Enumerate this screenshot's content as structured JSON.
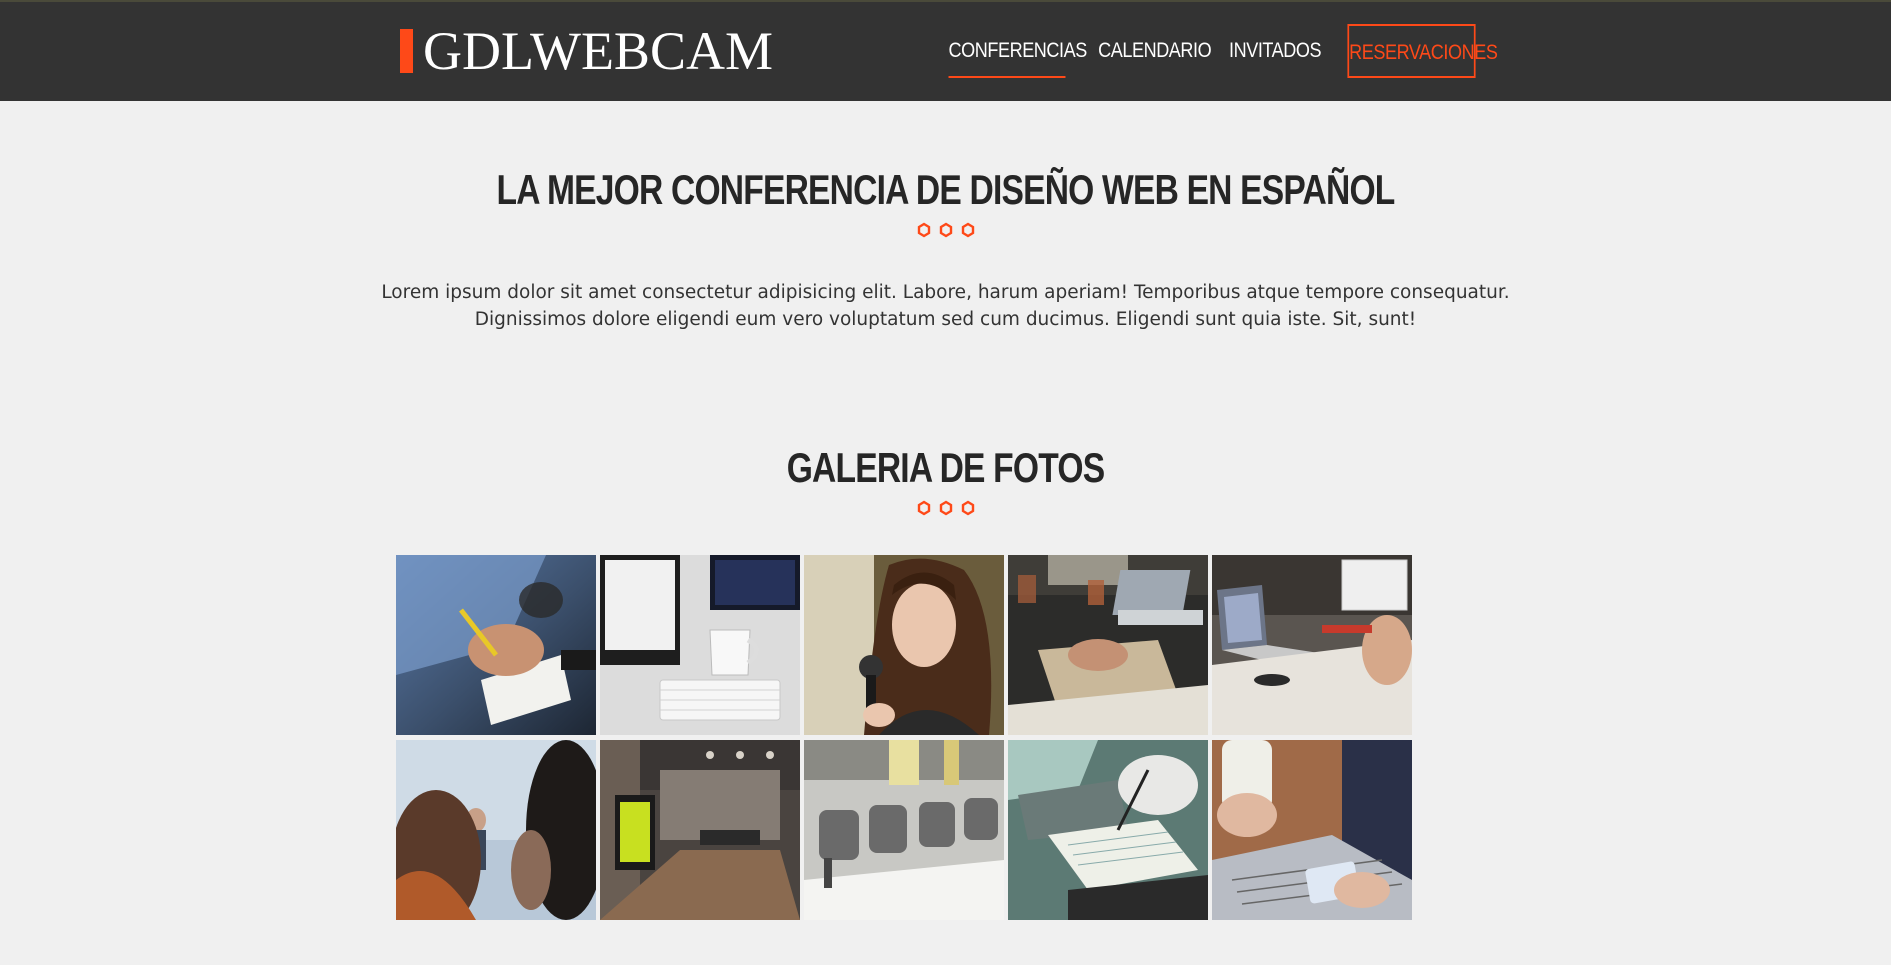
{
  "header": {
    "logo_text": "GDLWEBCAM",
    "accent_color": "#fe4918",
    "nav": [
      {
        "label": "CONFERENCIAS",
        "state": "active"
      },
      {
        "label": "CALENDARIO",
        "state": "normal"
      },
      {
        "label": "INVITADOS",
        "state": "normal"
      },
      {
        "label": "RESERVACIONES",
        "state": "outlined"
      }
    ]
  },
  "intro": {
    "title": "LA MEJOR CONFERENCIA DE DISEÑO WEB EN ESPAÑOL",
    "decoration_icon": "hexagon-icon",
    "paragraph_line1": "Lorem ipsum dolor sit amet consectetur adipisicing elit. Labore, harum aperiam! Temporibus atque tempore consequatur.",
    "paragraph_line2": "Dignissimos dolore eligendi eum vero voluptatum sed cum ducimus. Eligendi sunt quia iste. Sit, sunt!"
  },
  "gallery": {
    "title": "GALERIA DE FOTOS",
    "decoration_icon": "hexagon-icon",
    "photos": [
      {
        "subject": "hand-writing-notes-photo"
      },
      {
        "subject": "desk-monitor-mug-photo"
      },
      {
        "subject": "woman-with-microphone-photo"
      },
      {
        "subject": "laptop-table-meeting-photo"
      },
      {
        "subject": "laptops-desk-photo"
      },
      {
        "subject": "speaker-audience-photo"
      },
      {
        "subject": "office-hallway-photo"
      },
      {
        "subject": "empty-chairs-room-photo"
      },
      {
        "subject": "laptop-notebook-writing-photo"
      },
      {
        "subject": "phone-laptop-cup-photo"
      }
    ]
  }
}
